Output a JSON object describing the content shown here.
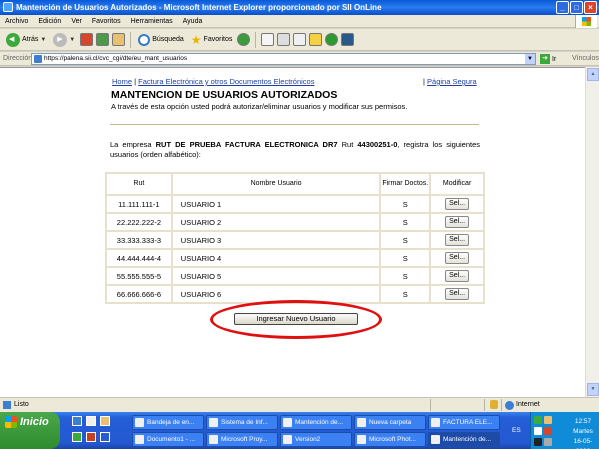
{
  "window": {
    "title": "Mantención de Usuarios Autorizados - Microsoft Internet Explorer proporcionado por SII OnLine",
    "buttons": {
      "minimize": "_",
      "maximize": "□",
      "close": "×"
    }
  },
  "menu": [
    "Archivo",
    "Edición",
    "Ver",
    "Favoritos",
    "Herramientas",
    "Ayuda"
  ],
  "toolbar": {
    "back_label": "Atrás",
    "search_label": "Búsqueda",
    "favorites_label": "Favoritos"
  },
  "address": {
    "label": "Dirección",
    "url": "https://palena.sii.cl/cvc_cgi/dte/eu_mant_usuarios",
    "go_label": "Ir",
    "links_label": "Vínculos"
  },
  "page": {
    "nav": {
      "home": "Home",
      "separator": "|",
      "factura": "Factura Electrónica y otros Documentos Electrónicos",
      "secure_sep": "|",
      "secure": "Página Segura"
    },
    "title": "MANTENCION DE USUARIOS AUTORIZADOS",
    "subtitle": "A través de esta opción usted podrá autorizar/eliminar usuarios y modificar sus permisos.",
    "intro_prefix": "La empresa",
    "company": "RUT DE PRUEBA FACTURA ELECTRONICA DR7",
    "intro_mid": "Rut",
    "company_rut": "44300251-0",
    "intro_suffix": ", registra los siguientes usuarios (orden alfabético):",
    "table": {
      "headers": {
        "rut": "Rut",
        "nombre": "Nombre Usuario",
        "firmar": "Firmar Doctos.",
        "modificar": "Modificar"
      },
      "rows": [
        {
          "rut": "11.111.111-1",
          "nombre": "USUARIO 1",
          "firmar": "S",
          "action": "Sel..."
        },
        {
          "rut": "22.222.222-2",
          "nombre": "USUARIO 2",
          "firmar": "S",
          "action": "Sel..."
        },
        {
          "rut": "33.333.333-3",
          "nombre": "USUARIO 3",
          "firmar": "S",
          "action": "Sel..."
        },
        {
          "rut": "44.444.444-4",
          "nombre": "USUARIO 4",
          "firmar": "S",
          "action": "Sel..."
        },
        {
          "rut": "55.555.555-5",
          "nombre": "USUARIO 5",
          "firmar": "S",
          "action": "Sel..."
        },
        {
          "rut": "66.666.666-6",
          "nombre": "USUARIO 6",
          "firmar": "S",
          "action": "Sel..."
        }
      ]
    },
    "add_button": "Ingresar Nuevo Usuario",
    "highlight_color": "#e01010"
  },
  "status": {
    "text": "Listo",
    "zone": "Internet"
  },
  "taskbar": {
    "start_label": "Inicio",
    "tasks_row1": [
      "Bandeja de en...",
      "Sistema de Inf...",
      "Mantención de...",
      "Nueva carpeta",
      "FACTURA ELE..."
    ],
    "tasks_row2": [
      "Documento1 - ...",
      "Microsoft Proy...",
      "Version2",
      "Microsoft Phot...",
      "Mantención de..."
    ],
    "lang": "ES",
    "clock_time": "12:57",
    "clock_day": "Martes",
    "clock_date": "16-05-2006"
  }
}
